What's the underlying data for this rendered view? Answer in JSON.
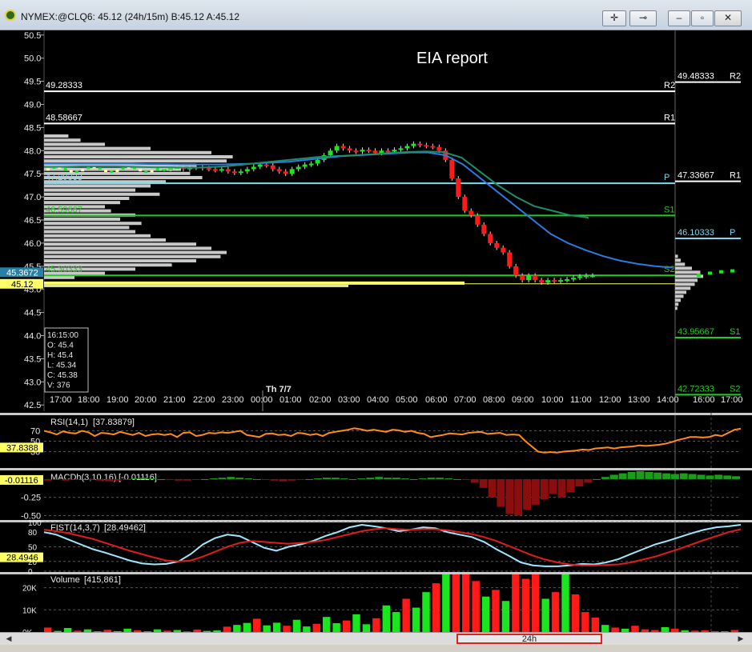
{
  "window": {
    "title": "NYMEX:@CLQ6: 45.12 (24h/15m)  B:45.12  A:45.12",
    "buttons": {
      "crosshair": "✛",
      "pin": "⊸",
      "minimize": "–",
      "restore": "▫",
      "close": "✕"
    }
  },
  "scrollbar": {
    "label": "24h",
    "left_arrow": "◀",
    "right_arrow": "▶"
  },
  "colors": {
    "up": "#19e61e",
    "down": "#ff1a1a",
    "support": "#22cc22",
    "pivot": "#7fd8ec",
    "resist": "#ffffff",
    "vwap": "#2b7be0",
    "ma": "#1e8e6a",
    "rsi": "#ff8c1a",
    "fist_fast": "#9fe8ff",
    "fist_slow": "#e01c1c",
    "highlight": "#ffff66"
  },
  "chart_data": [
    {
      "type": "candlestick",
      "annotation": "EIA report",
      "y_ticks": [
        "50.5",
        "50.0",
        "49.5",
        "49.0",
        "48.5",
        "48.0",
        "47.5",
        "47.0",
        "46.5",
        "46.0",
        "45.5",
        "45.0",
        "44.5",
        "44.0",
        "43.5",
        "43.0",
        "42.5"
      ],
      "ylim": [
        42.4,
        50.6
      ],
      "x_ticks": [
        "17:00",
        "18:00",
        "19:00",
        "20:00",
        "21:00",
        "22:00",
        "23:00",
        "00:00",
        "01:00",
        "02:00",
        "03:00",
        "04:00",
        "05:00",
        "06:00",
        "07:00",
        "08:00",
        "09:00",
        "10:00",
        "11:00",
        "12:00",
        "13:00",
        "14:00",
        "16:00",
        "17:00"
      ],
      "day_marker": "Th 7/7",
      "price_tags": [
        {
          "label": "45.3672",
          "value": 45.37
        },
        {
          "label": "45.12",
          "value": 45.12
        }
      ],
      "levels_left": [
        {
          "name": "R2",
          "label": "49.28333",
          "value": 49.283
        },
        {
          "name": "R1",
          "label": "48.58667",
          "value": 48.587
        },
        {
          "name": "P",
          "label": "47.29333",
          "value": 47.293
        },
        {
          "name": "S1",
          "label": "46.59667",
          "value": 46.597
        },
        {
          "name": "S2",
          "label": "45.30333",
          "value": 45.303
        }
      ],
      "levels_right": [
        {
          "name": "R2",
          "label": "49.48333",
          "value": 49.483
        },
        {
          "name": "R1",
          "label": "47.33667",
          "value": 47.337
        },
        {
          "name": "P",
          "label": "46.10333",
          "value": 46.103
        },
        {
          "name": "S1",
          "label": "43.95667",
          "value": 43.957
        },
        {
          "name": "S2",
          "label": "42.72333",
          "value": 42.723
        }
      ],
      "ohlc_box": {
        "time": "16:15:00",
        "O": "O: 45.4",
        "H": "H: 45.4",
        "L": "L: 45.34",
        "C": "C: 45.38",
        "V": "V: 376"
      },
      "candles_close": [
        47.6,
        47.62,
        47.64,
        47.6,
        47.63,
        47.65,
        47.62,
        47.6,
        47.58,
        47.6,
        47.55,
        47.52,
        47.55,
        47.6,
        47.65,
        47.7,
        47.68,
        47.6,
        47.55,
        47.5,
        47.6,
        47.65,
        47.7,
        47.72,
        47.8,
        47.9,
        48.0,
        48.1,
        48.05,
        48.0,
        47.98,
        48.02,
        48.0,
        47.95,
        48.0,
        47.98,
        48.02,
        48.05,
        48.1,
        48.15,
        48.12,
        48.1,
        48.08,
        48.0,
        47.8,
        47.4,
        47.0,
        46.7,
        46.6,
        46.4,
        46.2,
        46.0,
        45.9,
        45.8,
        45.5,
        45.3,
        45.2,
        45.3,
        45.2,
        45.15,
        45.2,
        45.18,
        45.2,
        45.22,
        45.25,
        45.28,
        45.3,
        45.3
      ],
      "vwap": [
        47.72,
        47.72,
        47.72,
        47.72,
        47.72,
        47.72,
        47.71,
        47.71,
        47.7,
        47.7,
        47.7,
        47.71,
        47.72,
        47.74,
        47.76,
        47.8,
        47.84,
        47.88,
        47.9,
        47.92,
        47.94,
        47.96,
        47.96,
        47.9,
        47.7,
        47.4,
        47.1,
        46.8,
        46.5,
        46.2,
        46.0,
        45.85,
        45.72,
        45.62,
        45.55,
        45.5,
        45.47
      ],
      "ma": [
        47.65,
        47.65,
        47.66,
        47.66,
        47.66,
        47.65,
        47.64,
        47.64,
        47.63,
        47.64,
        47.66,
        47.7,
        47.74,
        47.78,
        47.82,
        47.86,
        47.88,
        47.9,
        47.92,
        47.95,
        47.97,
        47.98,
        47.97,
        47.85,
        47.55,
        47.25,
        47.0,
        46.8,
        46.7,
        46.6,
        46.55
      ],
      "profile_left": [
        0.08,
        0.12,
        0.2,
        0.35,
        0.55,
        0.62,
        0.6,
        0.5,
        0.45,
        0.48,
        0.52,
        0.4,
        0.35,
        0.3,
        0.38,
        0.28,
        0.25,
        0.2,
        0.22,
        0.3,
        0.25,
        0.32,
        0.28,
        0.3,
        0.35,
        0.4,
        0.5,
        0.55,
        0.6,
        0.58,
        0.5,
        0.42,
        0.3,
        0.2,
        0.1
      ],
      "profile_right": [
        0.1,
        0.2,
        0.35,
        0.6,
        0.9,
        1.0,
        0.8,
        0.7,
        0.55,
        0.4,
        0.3,
        0.2,
        0.12,
        0.08
      ]
    },
    {
      "type": "line",
      "title": "RSI(14,1)",
      "readout": "[37.83879]",
      "tag": "37.8388",
      "y_ticks": [
        "70",
        "50",
        "30"
      ],
      "values": [
        70,
        67,
        63,
        69,
        66,
        65,
        70,
        67,
        60,
        66,
        65,
        63,
        68,
        65,
        62,
        66,
        60,
        63,
        64,
        62,
        64,
        58,
        66,
        67,
        60,
        62,
        66,
        65,
        67,
        66,
        68,
        70,
        62,
        60,
        58,
        64,
        65,
        62,
        63,
        60,
        66,
        65,
        62,
        64,
        60,
        66,
        68,
        70,
        72,
        75,
        73,
        70,
        72,
        70,
        68,
        72,
        71,
        68,
        70,
        66,
        64,
        58,
        60,
        62,
        65,
        64,
        63,
        66,
        67,
        68,
        64,
        65,
        66,
        62,
        63,
        62,
        50,
        40,
        30,
        28,
        29,
        28,
        30,
        31,
        32,
        34,
        33,
        36,
        37,
        38,
        36,
        38,
        39,
        40,
        42,
        41,
        42,
        43,
        45,
        48,
        52,
        55,
        58,
        58,
        57,
        58,
        62,
        60,
        66,
        72,
        74
      ]
    },
    {
      "type": "bar",
      "title": "MACDh(3,10,16)",
      "readout": "[-0.01116]",
      "tag": "-0.01116",
      "y_ticks": [
        "-0.25",
        "-0.50"
      ],
      "ylim": [
        -0.55,
        0.12
      ],
      "values": [
        -0.02,
        -0.01,
        -0.02,
        -0.01,
        0,
        -0.01,
        -0.02,
        -0.03,
        -0.02,
        -0.01,
        0.01,
        0.02,
        0.01,
        0,
        -0.01,
        -0.02,
        -0.02,
        -0.01,
        0,
        0.01,
        0.02,
        0.03,
        0.02,
        0.01,
        0,
        -0.01,
        -0.02,
        -0.03,
        -0.02,
        -0.01,
        0,
        0.01,
        0.02,
        0.02,
        0.01,
        0,
        0.01,
        0.02,
        0.03,
        0.02,
        0.02,
        0.01,
        0,
        0.01,
        0.02,
        0.02,
        0.01,
        0,
        -0.01,
        -0.05,
        -0.12,
        -0.25,
        -0.38,
        -0.48,
        -0.5,
        -0.42,
        -0.35,
        -0.28,
        -0.2,
        -0.25,
        -0.18,
        -0.1,
        -0.05,
        0,
        0.03,
        0.06,
        0.08,
        0.1,
        0.11,
        0.1,
        0.09,
        0.08,
        0.07,
        0.08,
        0.07,
        0.06,
        0.05,
        0.06,
        0.05,
        0.04
      ]
    },
    {
      "type": "line",
      "title": "FIST(14,3,7)",
      "readout": "[28.49462]",
      "tag": "28.4946",
      "y_ticks": [
        "100",
        "80",
        "50",
        "20",
        "0"
      ],
      "fast": [
        80,
        75,
        65,
        55,
        45,
        38,
        30,
        22,
        16,
        14,
        15,
        20,
        35,
        55,
        68,
        75,
        72,
        60,
        48,
        42,
        50,
        55,
        62,
        72,
        80,
        90,
        95,
        92,
        88,
        82,
        85,
        90,
        88,
        80,
        75,
        70,
        60,
        45,
        32,
        18,
        12,
        10,
        10,
        12,
        15,
        14,
        18,
        25,
        35,
        45,
        55,
        62,
        70,
        78,
        85,
        90,
        92,
        95
      ],
      "slow": [
        85,
        82,
        78,
        72,
        66,
        58,
        50,
        42,
        35,
        28,
        22,
        20,
        22,
        30,
        40,
        50,
        58,
        62,
        60,
        58,
        56,
        58,
        60,
        64,
        70,
        76,
        82,
        86,
        88,
        86,
        85,
        86,
        86,
        84,
        80,
        76,
        70,
        62,
        52,
        42,
        32,
        24,
        18,
        14,
        12,
        12,
        13,
        14,
        18,
        24,
        30,
        38,
        46,
        55,
        64,
        72,
        80,
        86
      ]
    },
    {
      "type": "bar",
      "title": "Volume",
      "readout": "[415,861]",
      "y_ticks": [
        "20K",
        "10K",
        "0K"
      ],
      "ylim": [
        0,
        26000
      ],
      "values": [
        2000,
        500,
        1800,
        600,
        1200,
        300,
        1000,
        400,
        1500,
        800,
        300,
        1200,
        600,
        900,
        200,
        1100,
        500,
        700,
        2400,
        3200,
        4100,
        6000,
        3000,
        4200,
        2800,
        5500,
        2500,
        3700,
        6800,
        4000,
        5200,
        8000,
        3500,
        6200,
        12000,
        9000,
        15000,
        11000,
        18000,
        22000,
        26000,
        26000,
        26000,
        23000,
        16000,
        19000,
        14000,
        26000,
        24000,
        26000,
        15000,
        18000,
        26000,
        17000,
        9000,
        6500,
        3200,
        2000,
        1500,
        2800,
        1200,
        900,
        2200,
        1500,
        800,
        600,
        700,
        400,
        300,
        900
      ]
    }
  ]
}
